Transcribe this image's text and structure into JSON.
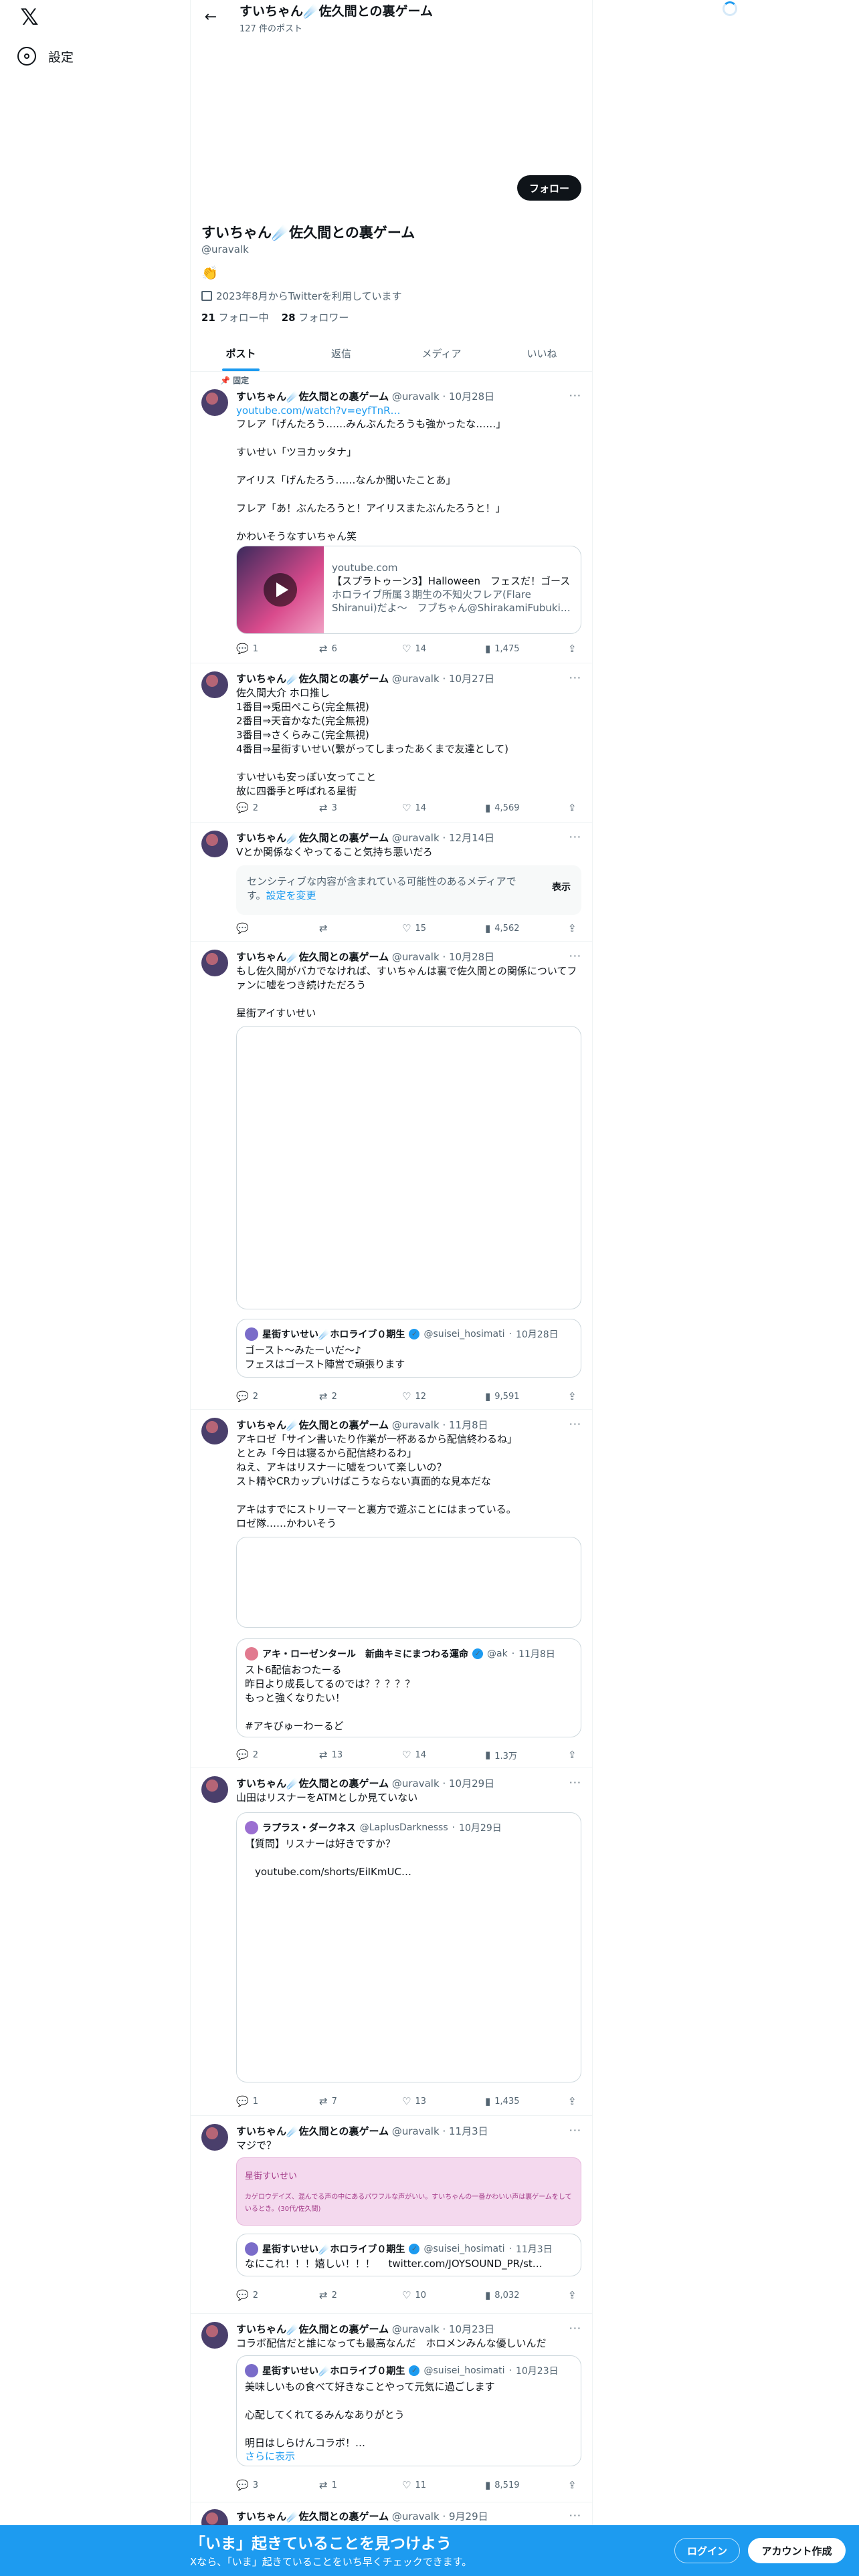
{
  "nav": {
    "settings_label": "設定"
  },
  "topbar": {
    "title": "すいちゃん☄️佐久間との裏ゲーム",
    "post_count": "127 件のポスト"
  },
  "profile": {
    "follow_label": "フォロー",
    "name": "すいちゃん☄️佐久間との裏ゲーム",
    "handle": "@uravalk",
    "bio_emoji": "👏",
    "joined": "2023年8月からTwitterを利用しています",
    "following_count": "21",
    "following_label": "フォロー中",
    "followers_count": "28",
    "followers_label": "フォロワー"
  },
  "tabs": [
    "ポスト",
    "返信",
    "メディア",
    "いいね"
  ],
  "pinned_label": "固定",
  "author": {
    "name": "すいちゃん☄️佐久間との裏ゲーム",
    "handle": "@uravalk"
  },
  "tweets": [
    {
      "date": "10月28日",
      "link": "youtube.com/watch?v=eyfTnR…",
      "text": "フレア「げんたろう……みんぶんたろうも強かったな……」\n\nすいせい「ツヨカッタナ」\n\nアイリス「げんたろう……なんか聞いたことあ」\n\nフレア「あ！ぶんたろうと！アイリスまたぶんたろうと！」\n\nかわいそうなすいちゃん笑",
      "card": {
        "domain": "youtube.com",
        "title": "【スプラトゥーン3】Halloween　フェスだ！ゴース",
        "desc": "ホロライブ所属３期生の不知火フレア(Flare Shiranui)だよ～　フブちゃん@ShirakamiFubuki…"
      },
      "replies": "1",
      "reposts": "6",
      "likes": "14",
      "views": "1,475"
    },
    {
      "date": "10月27日",
      "text": "佐久間大介 ホロ推し\n1番目⇒兎田ぺこら(完全無視)\n2番目⇒天音かなた(完全無視)\n3番目⇒さくらみこ(完全無視)\n4番目⇒星街すいせい(繋がってしまったあくまで友達として)\n\nすいせいも安っぽい女ってこと\n故に四番手と呼ばれる星街",
      "replies": "2",
      "reposts": "3",
      "likes": "14",
      "views": "4,569"
    },
    {
      "date": "12月14日",
      "text": "Vとか関係なくやってること気持ち悪いだろ",
      "sensitive_text": "センシティブな内容が含まれている可能性のあるメディアです。",
      "sensitive_link": "設定を変更",
      "sensitive_btn": "表示",
      "replies": "",
      "reposts": "",
      "likes": "15",
      "views": "4,562"
    },
    {
      "date": "10月28日",
      "text": "もし佐久間がバカでなければ、すいちゃんは裏で佐久間との関係についてファンに嘘をつき続けただろう\n\n星街アイすいせい",
      "quote": {
        "name": "星街すいせい☄️ホロライブ０期生",
        "handle": "@suisei_hosimati",
        "date": "10月28日",
        "text": "ゴースト〜みたーいだ〜♪\nフェスはゴースト陣営で頑張ります"
      },
      "replies": "2",
      "reposts": "2",
      "likes": "12",
      "views": "9,591"
    },
    {
      "date": "11月8日",
      "text": "アキロゼ「サイン書いたり作業が一杯あるから配信終わるね」\nととみ「今日は寝るから配信終わるわ」\nねえ、アキはリスナーに嘘をついて楽しいの？\nスト精やCRカップいけばこうならない真面的な見本だな\n\nアキはすでにストリーマーと裏方で遊ぶことにはまっている。\nロゼ隊……かわいそう",
      "quote": {
        "name": "アキ・ローゼンタール　新曲キミにまつわる運命",
        "handle": "@ak",
        "date": "11月8日",
        "text": "スト6配信おつたーる\n昨日より成長してるのでは？？？？？\nもっと強くなりたい！\n\n#アキびゅーわーるど"
      },
      "replies": "2",
      "reposts": "13",
      "likes": "14",
      "views": "1.3万"
    },
    {
      "date": "10月29日",
      "text": "山田はリスナーをATMとしか見ていない",
      "quote": {
        "name": "ラプラス・ダークネス",
        "handle": "@LaplusDarknesss",
        "date": "10月29日",
        "text": "【質問】リスナーは好きですか？\n\n　youtube.com/shorts/EiIKmUC…"
      },
      "replies": "1",
      "reposts": "7",
      "likes": "13",
      "views": "1,435"
    },
    {
      "date": "11月3日",
      "text": "マジで？",
      "pink": {
        "title": "星街すいせい",
        "text": "カゲロウデイズ、混んでる声の中にあるパワフルな声がいい。すいちゃんの一番かわいい声は裏ゲームをしているとき。(30代/佐久間)"
      },
      "quote": {
        "name": "星街すいせい☄️ホロライブ０期生",
        "handle": "@suisei_hosimati",
        "date": "11月3日",
        "text": "なにこれ！！！嬉しい！！！　 twitter.com/JOYSOUND_PR/st…"
      },
      "replies": "2",
      "reposts": "2",
      "likes": "10",
      "views": "8,032"
    },
    {
      "date": "10月23日",
      "text": "コラボ配信だと誰になっても最高なんだ　ホロメンみんな優しいんだ",
      "quote": {
        "name": "星街すいせい☄️ホロライブ０期生",
        "handle": "@suisei_hosimati",
        "date": "10月23日",
        "text": "美味しいもの食べて好きなことやって元気に過ごします\n\n心配してくれてるみんなありがとう\n\n明日はしらけんコラボ！…",
        "more": "さらに表示"
      },
      "replies": "3",
      "reposts": "1",
      "likes": "11",
      "views": "8,519"
    },
    {
      "date": "9月29日"
    }
  ],
  "bottom": {
    "title": "「いま」起きていることを見つけよう",
    "sub": "Xなら、「いま」起きていることをいち早くチェックできます。",
    "login": "ログイン",
    "signup": "アカウント作成"
  },
  "colors": {
    "accent": "#1d9bf0",
    "text": "#0f1419",
    "secondary": "#536471",
    "border": "#cfd9de"
  }
}
